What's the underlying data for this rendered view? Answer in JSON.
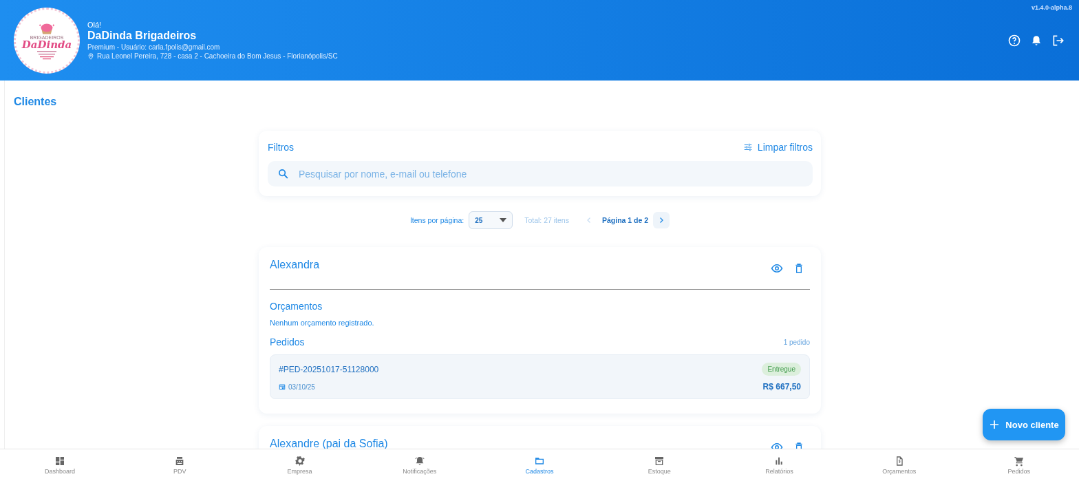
{
  "header": {
    "logo": {
      "tagline": "BRIGADEIROS",
      "brand": "DaDinda"
    },
    "greeting": "Olá!",
    "company": "DaDinda Brigadeiros",
    "plan": "Premium - Usuário: carla.fpolis@gmail.com",
    "address": "Rua Leonel Pereira, 728 - casa 2 - Cachoeira do Bom Jesus - Florianópolis/SC",
    "version": "v1.4.0-alpha.8"
  },
  "page": {
    "title": "Clientes"
  },
  "filters": {
    "title": "Filtros",
    "clear": "Limpar filtros",
    "search": {
      "placeholder": "Pesquisar por nome, e-mail ou telefone"
    }
  },
  "pagination": {
    "per_page_label": "Itens por página:",
    "per_page": "25",
    "total": "Total: 27 itens",
    "page": "Página 1 de 2",
    "prev": {
      "disabled": true
    },
    "next": {
      "disabled": false
    }
  },
  "clients": [
    {
      "name": "Alexandra",
      "budgets": {
        "title": "Orçamentos",
        "empty": "Nenhum orçamento registrado."
      },
      "orders": {
        "title": "Pedidos",
        "count": "1 pedido",
        "items": [
          {
            "code": "#PED-20251017-51128000",
            "status": "Entregue",
            "date": "03/10/25",
            "total": "R$ 667,50"
          }
        ]
      }
    },
    {
      "name": "Alexandre (pai da Sofia)"
    }
  ],
  "fab": {
    "label": "Novo cliente"
  },
  "nav": [
    {
      "label": "Dashboard",
      "selected": false
    },
    {
      "label": "PDV",
      "selected": false
    },
    {
      "label": "Empresa",
      "selected": false
    },
    {
      "label": "Notificações",
      "selected": false
    },
    {
      "label": "Cadastros",
      "selected": true
    },
    {
      "label": "Estoque",
      "selected": false
    },
    {
      "label": "Relatórios",
      "selected": false
    },
    {
      "label": "Orçamentos",
      "selected": false
    },
    {
      "label": "Pedidos",
      "selected": false
    }
  ]
}
